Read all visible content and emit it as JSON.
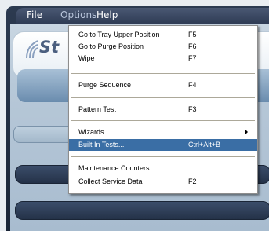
{
  "menubar": {
    "items": [
      {
        "label": "File"
      },
      {
        "label": "Options"
      },
      {
        "label": "Help"
      }
    ]
  },
  "app": {
    "logo_text": "St"
  },
  "options_menu": {
    "items": [
      {
        "label": "Go to Tray Upper Position",
        "shortcut": "F5"
      },
      {
        "label": "Go to Purge Position",
        "shortcut": "F6"
      },
      {
        "label": "Wipe",
        "shortcut": "F7"
      },
      {
        "label": "Purge Sequence",
        "shortcut": "F4"
      },
      {
        "label": "Pattern Test",
        "shortcut": "F3"
      },
      {
        "label": "Wizards",
        "shortcut": "",
        "submenu": true
      },
      {
        "label": "Built In Tests...",
        "shortcut": "Ctrl+Alt+B",
        "highlighted": true
      },
      {
        "label": "Maintenance Counters...",
        "shortcut": ""
      },
      {
        "label": "Collect Service Data",
        "shortcut": "F2"
      }
    ]
  },
  "colors": {
    "highlight": "#3a6ea5",
    "menubar": "#2f3c55",
    "logo": "#4b5f7f"
  }
}
